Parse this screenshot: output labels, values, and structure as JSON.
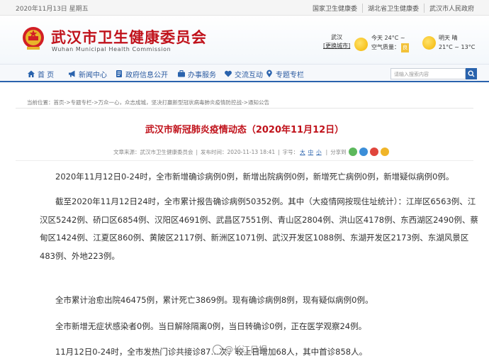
{
  "topbar": {
    "date": "2020年11月13日 星期五",
    "links": [
      "国家卫生健康委",
      "湖北省卫生健康委",
      "武汉市人民政府"
    ]
  },
  "header": {
    "title": "武汉市卫生健康委员会",
    "subtitle": "Wuhan Municipal Health Commission",
    "weather": {
      "city": "武汉",
      "switch_city": "[更换城市]",
      "today_label": "今天",
      "today_temp": "24°C ~",
      "air_quality_label": "空气质量：",
      "air_quality_value": "良",
      "tomorrow_label": "明天",
      "tomorrow_cond": "晴",
      "tomorrow_temp": "21°C ~ 13°C"
    }
  },
  "nav": {
    "items": [
      {
        "label": "首 页",
        "icon": "home-icon"
      },
      {
        "label": "新闻中心",
        "icon": "megaphone-icon"
      },
      {
        "label": "政府信息公开",
        "icon": "document-icon"
      },
      {
        "label": "办事服务",
        "icon": "briefcase-icon"
      },
      {
        "label": "交流互动",
        "icon": "heart-icon"
      },
      {
        "label": "专题专栏",
        "icon": "pin-icon"
      }
    ],
    "search_placeholder": "请输入搜索内容"
  },
  "breadcrumb": "当前位置：首页->专题专栏->万众一心，众志成城，坚决打赢新型冠状病毒肺炎疫情防控战->通知公告",
  "article": {
    "title": "武汉市新冠肺炎疫情动态（2020年11月12日）",
    "source": "文章来源：武汉市卫生健康委员会",
    "published": "发布时间：2020-11-13 18:41",
    "font_size_label": "字号：",
    "size_large": "大",
    "size_medium": "中",
    "size_small": "小",
    "share_label": "分享到",
    "paragraphs": [
      "2020年11月12日0-24时，全市新增确诊病例0例，新增出院病例0例，新增死亡病例0例，新增疑似病例0例。",
      "截至2020年11月12日24时，全市累计报告确诊病例50352例。其中（大疫情网按现住址统计）：江岸区6563例、江汉区5242例、硚口区6854例、汉阳区4691例、武昌区7551例、青山区2804例、洪山区4178例、东西湖区2490例、蔡甸区1424例、江夏区860例、黄陂区2117例、新洲区1071例、武汉开发区1088例、东湖开发区2173例、东湖风景区483例、外地223例。",
      "全市累计治愈出院46475例，累计死亡3869例。现有确诊病例8例，现有疑似病例0例。",
      "全市新增无症状感染者0例。当日解除隔离0例，当日转确诊0例，正在医学观察24例。",
      "11月12日0-24时，全市发热门诊共接诊87…次，较上日增加68人，其中首诊858人。"
    ]
  },
  "watermark": "@长江日报"
}
